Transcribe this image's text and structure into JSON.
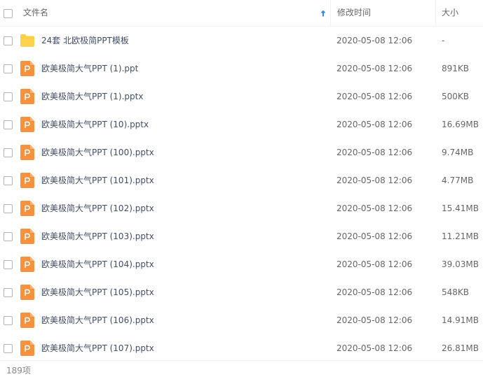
{
  "header": {
    "name_label": "文件名",
    "time_label": "修改时间",
    "size_label": "大小"
  },
  "colors": {
    "folder": "#ffd24d",
    "ppt_icon": "#f7913e",
    "sort_arrow": "#2b8de8"
  },
  "rows": [
    {
      "name": "24套 北欧极简PPT模板",
      "time": "2020-05-08 12:06",
      "size": "-",
      "icon": "folder-icon"
    },
    {
      "name": "欧美极简大气PPT (1).ppt",
      "time": "2020-05-08 12:06",
      "size": "891KB",
      "icon": "ppt-file-icon"
    },
    {
      "name": "欧美极简大气PPT (1).pptx",
      "time": "2020-05-08 12:06",
      "size": "500KB",
      "icon": "ppt-file-icon"
    },
    {
      "name": "欧美极简大气PPT (10).pptx",
      "time": "2020-05-08 12:06",
      "size": "16.69MB",
      "icon": "ppt-file-icon"
    },
    {
      "name": "欧美极简大气PPT (100).pptx",
      "time": "2020-05-08 12:06",
      "size": "9.74MB",
      "icon": "ppt-file-icon"
    },
    {
      "name": "欧美极简大气PPT (101).pptx",
      "time": "2020-05-08 12:06",
      "size": "4.77MB",
      "icon": "ppt-file-icon"
    },
    {
      "name": "欧美极简大气PPT (102).pptx",
      "time": "2020-05-08 12:06",
      "size": "15.41MB",
      "icon": "ppt-file-icon"
    },
    {
      "name": "欧美极简大气PPT (103).pptx",
      "time": "2020-05-08 12:06",
      "size": "11.21MB",
      "icon": "ppt-file-icon"
    },
    {
      "name": "欧美极简大气PPT (104).pptx",
      "time": "2020-05-08 12:06",
      "size": "39.03MB",
      "icon": "ppt-file-icon"
    },
    {
      "name": "欧美极简大气PPT (105).pptx",
      "time": "2020-05-08 12:06",
      "size": "548KB",
      "icon": "ppt-file-icon"
    },
    {
      "name": "欧美极简大气PPT (106).pptx",
      "time": "2020-05-08 12:06",
      "size": "14.91MB",
      "icon": "ppt-file-icon"
    },
    {
      "name": "欧美极简大气PPT (107).pptx",
      "time": "2020-05-08 12:06",
      "size": "26.81MB",
      "icon": "ppt-file-icon"
    }
  ],
  "footer": {
    "count_label": "189项"
  }
}
